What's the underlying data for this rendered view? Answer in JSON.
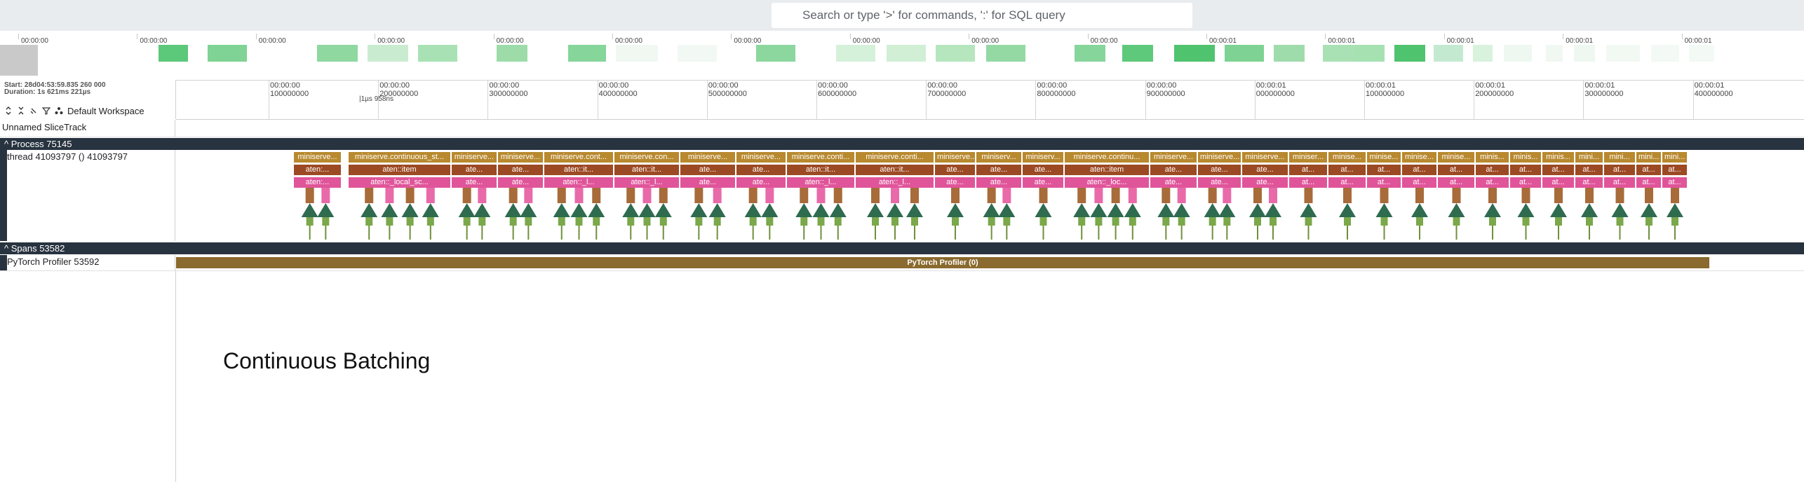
{
  "search": {
    "placeholder": "Search or type '>' for commands, ':' for SQL query"
  },
  "overview": {
    "ticks": [
      "00:00:00",
      "00:00:00",
      "00:00:00",
      "00:00:00",
      "00:00:00",
      "00:00:00",
      "00:00:00",
      "00:00:00",
      "00:00:00",
      "00:00:00",
      "00:00:01",
      "00:00:01",
      "00:00:01",
      "00:00:01",
      "00:00:01"
    ]
  },
  "header": {
    "start": "Start: 28d04:53:59.835 260 000",
    "duration": "Duration: 1s 621ms 221µs",
    "workspace": "Default Workspace"
  },
  "ruler": {
    "ticks": [
      {
        "t": "00:00:00",
        "v": "100000000"
      },
      {
        "t": "00:00:00",
        "v": "200000000"
      },
      {
        "t": "00:00:00",
        "v": "300000000"
      },
      {
        "t": "00:00:00",
        "v": "400000000"
      },
      {
        "t": "00:00:00",
        "v": "500000000"
      },
      {
        "t": "00:00:00",
        "v": "600000000"
      },
      {
        "t": "00:00:00",
        "v": "700000000"
      },
      {
        "t": "00:00:00",
        "v": "800000000"
      },
      {
        "t": "00:00:00",
        "v": "900000000"
      },
      {
        "t": "00:00:01",
        "v": "000000000"
      },
      {
        "t": "00:00:01",
        "v": "100000000"
      },
      {
        "t": "00:00:01",
        "v": "200000000"
      },
      {
        "t": "00:00:01",
        "v": "300000000"
      },
      {
        "t": "00:00:01",
        "v": "400000000"
      }
    ],
    "cursor": "|1µs 958ns"
  },
  "tracks": {
    "unnamed": "Unnamed SliceTrack",
    "process": "Process 75145",
    "thread": "thread 41093797 () 41093797",
    "spans": "Spans 53582",
    "profiler": "PyTorch Profiler 53592",
    "profiler_slice": "PyTorch Profiler (0)"
  },
  "slices": {
    "top": [
      "miniserve...",
      "miniserve.continuous_st...",
      "miniserve...",
      "miniserve...",
      "miniserve.cont...",
      "miniserve.con...",
      "miniserve...",
      "miniserve...",
      "miniserve.conti...",
      "miniserve.conti...",
      "miniserve...",
      "miniserv...",
      "miniserv...",
      "miniserve.continu...",
      "miniserve...",
      "miniserve...",
      "miniserve...",
      "miniser...",
      "minise...",
      "minise...",
      "minise...",
      "minise...",
      "minis...",
      "minis...",
      "minis...",
      "mini...",
      "mini...",
      "mini...",
      "mini..."
    ],
    "mid": [
      "aten:...",
      "aten::item",
      "ate...",
      "ate...",
      "aten::it...",
      "aten::it...",
      "ate...",
      "ate...",
      "aten::it...",
      "aten::it...",
      "ate...",
      "ate...",
      "ate...",
      "aten::item",
      "ate...",
      "ate...",
      "ate...",
      "at...",
      "at...",
      "at...",
      "at...",
      "at...",
      "at...",
      "at...",
      "at...",
      "at...",
      "at...",
      "at...",
      "at..."
    ],
    "bottom": [
      "aten:...",
      "aten::_local_sc...",
      "ate...",
      "ate...",
      "aten::_l...",
      "aten::_l...",
      "ate...",
      "ate...",
      "aten::_l...",
      "aten::_l...",
      "ate...",
      "ate...",
      "ate...",
      "aten::_loc...",
      "ate...",
      "ate...",
      "ate...",
      "at...",
      "at...",
      "at...",
      "at...",
      "at...",
      "at...",
      "at...",
      "at...",
      "at...",
      "at...",
      "at...",
      "at..."
    ]
  },
  "overlay": "Continuous Batching",
  "colors": {
    "topbar": "#e9ecef",
    "group_header": "#283340",
    "slice_top": "#b8892f",
    "slice_mid": "#9c4a24",
    "slice_bottom": "#e0559a",
    "profiler": "#8a6a2e",
    "arrow": "#2e6b4f"
  }
}
